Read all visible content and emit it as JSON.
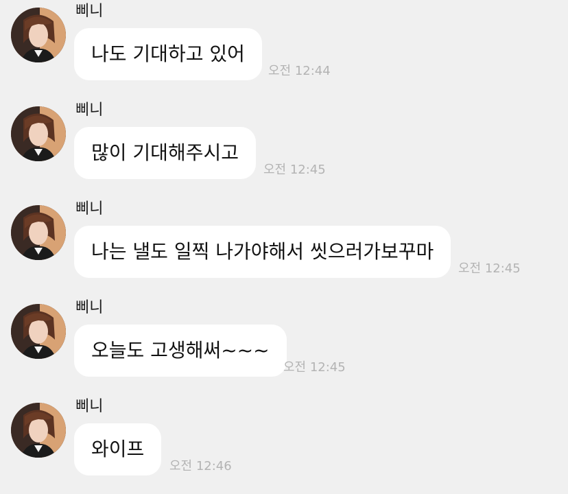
{
  "colors": {
    "background": "#f0f0f0",
    "bubble": "#ffffff",
    "timestamp": "#b3b3b3"
  },
  "messages": [
    {
      "sender": "삐니",
      "text": "나도 기대하고 있어",
      "time": "오전 12:44"
    },
    {
      "sender": "삐니",
      "text": "많이 기대해주시고",
      "time": "오전 12:45"
    },
    {
      "sender": "삐니",
      "text": "나는 낼도 일찍 나가야해서 씻으러가보꾸마",
      "time": "오전 12:45"
    },
    {
      "sender": "삐니",
      "text": "오늘도 고생해써~~~",
      "time": "오전 12:45"
    },
    {
      "sender": "삐니",
      "text": "와이프",
      "time": "오전 12:46"
    }
  ]
}
